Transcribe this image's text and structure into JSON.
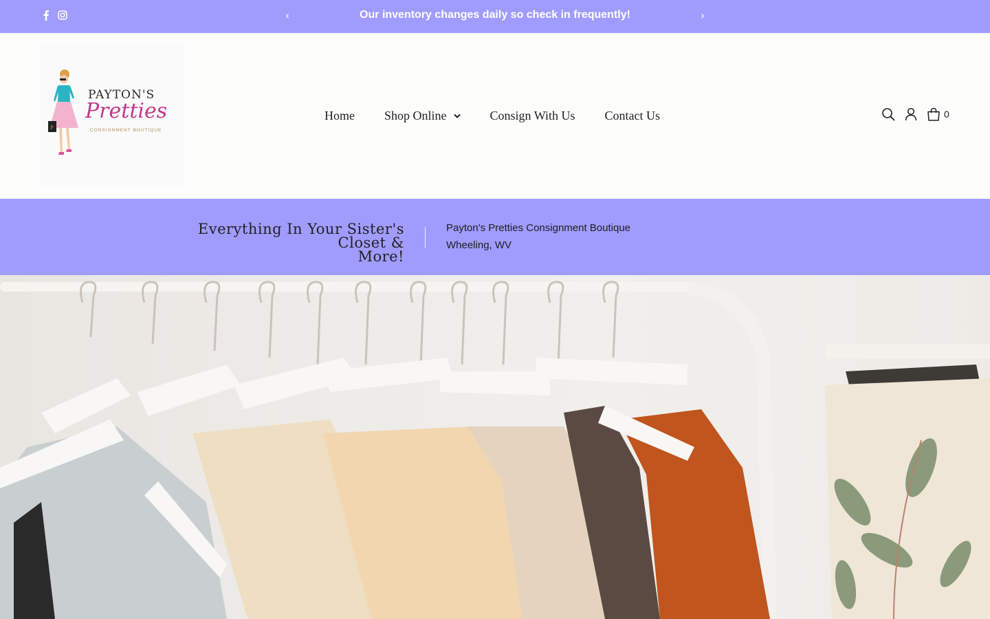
{
  "announcement": {
    "message": "Our inventory changes daily so check in frequently!",
    "prev_arrow": "‹",
    "next_arrow": "›",
    "social": [
      "facebook-icon",
      "instagram-icon"
    ]
  },
  "logo": {
    "line1": "PAYTON'S",
    "line2": "Pretties",
    "line3": "CONSIGNMENT BOUTIQUE"
  },
  "nav": {
    "items": [
      {
        "label": "Home"
      },
      {
        "label": "Shop Online",
        "has_dropdown": true
      },
      {
        "label": "Consign With Us"
      },
      {
        "label": "Contact Us"
      }
    ]
  },
  "tools": {
    "icons": [
      "search-icon",
      "account-icon",
      "cart-icon"
    ],
    "cart_count": "0"
  },
  "band": {
    "tagline_line1": "Everything In Your Sister's Closet &",
    "tagline_line2": "More!",
    "store_name": "Payton's Pretties Consignment Boutique",
    "location": "Wheeling, WV"
  },
  "colors": {
    "accent": "#a09cfd",
    "brand_pink": "#c4368a"
  }
}
